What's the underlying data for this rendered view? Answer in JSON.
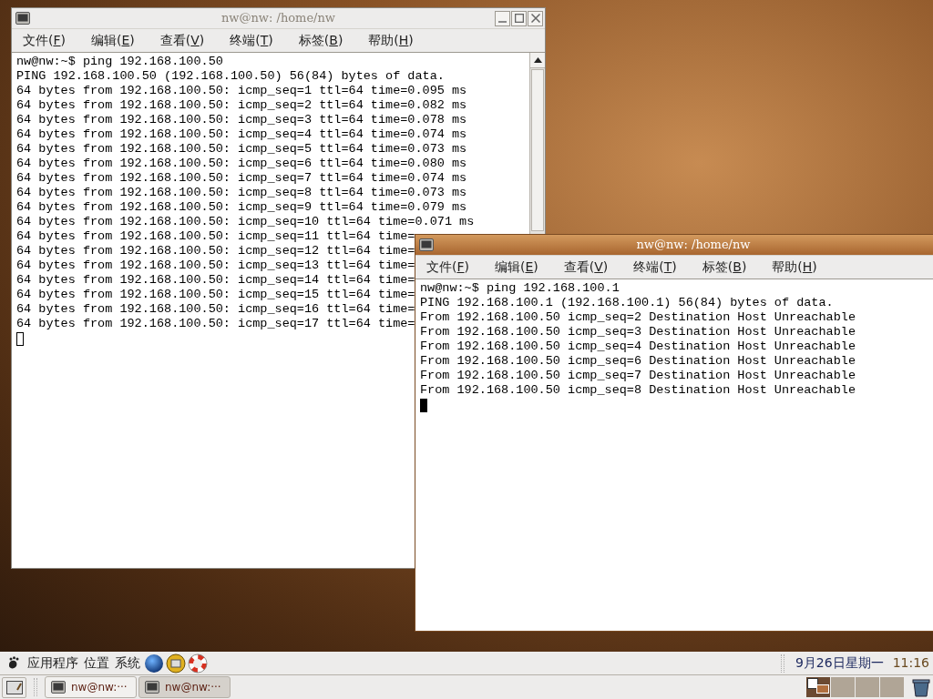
{
  "windows": [
    {
      "title": "nw@nw: /home/nw",
      "active": false,
      "controls_shown": true,
      "menu": [
        "文件(F)",
        "编辑(E)",
        "查看(V)",
        "终端(T)",
        "标签(B)",
        "帮助(H)"
      ],
      "lines": [
        "nw@nw:~$ ping 192.168.100.50",
        "PING 192.168.100.50 (192.168.100.50) 56(84) bytes of data.",
        "64 bytes from 192.168.100.50: icmp_seq=1 ttl=64 time=0.095 ms",
        "64 bytes from 192.168.100.50: icmp_seq=2 ttl=64 time=0.082 ms",
        "64 bytes from 192.168.100.50: icmp_seq=3 ttl=64 time=0.078 ms",
        "64 bytes from 192.168.100.50: icmp_seq=4 ttl=64 time=0.074 ms",
        "64 bytes from 192.168.100.50: icmp_seq=5 ttl=64 time=0.073 ms",
        "64 bytes from 192.168.100.50: icmp_seq=6 ttl=64 time=0.080 ms",
        "64 bytes from 192.168.100.50: icmp_seq=7 ttl=64 time=0.074 ms",
        "64 bytes from 192.168.100.50: icmp_seq=8 ttl=64 time=0.073 ms",
        "64 bytes from 192.168.100.50: icmp_seq=9 ttl=64 time=0.079 ms",
        "64 bytes from 192.168.100.50: icmp_seq=10 ttl=64 time=0.071 ms",
        "64 bytes from 192.168.100.50: icmp_seq=11 ttl=64 time=",
        "64 bytes from 192.168.100.50: icmp_seq=12 ttl=64 time=",
        "64 bytes from 192.168.100.50: icmp_seq=13 ttl=64 time=",
        "64 bytes from 192.168.100.50: icmp_seq=14 ttl=64 time=",
        "64 bytes from 192.168.100.50: icmp_seq=15 ttl=64 time=",
        "64 bytes from 192.168.100.50: icmp_seq=16 ttl=64 time=",
        "64 bytes from 192.168.100.50: icmp_seq=17 ttl=64 time="
      ]
    },
    {
      "title": "nw@nw: /home/nw",
      "active": true,
      "controls_shown": false,
      "menu": [
        "文件(F)",
        "编辑(E)",
        "查看(V)",
        "终端(T)",
        "标签(B)",
        "帮助(H)"
      ],
      "lines": [
        "nw@nw:~$ ping 192.168.100.1",
        "PING 192.168.100.1 (192.168.100.1) 56(84) bytes of data.",
        "From 192.168.100.50 icmp_seq=2 Destination Host Unreachable",
        "From 192.168.100.50 icmp_seq=3 Destination Host Unreachable",
        "From 192.168.100.50 icmp_seq=4 Destination Host Unreachable",
        "From 192.168.100.50 icmp_seq=6 Destination Host Unreachable",
        "From 192.168.100.50 icmp_seq=7 Destination Host Unreachable",
        "From 192.168.100.50 icmp_seq=8 Destination Host Unreachable"
      ]
    }
  ],
  "top_panel": {
    "menus": [
      "应用程序",
      "位置",
      "系统"
    ],
    "date": "9月26日星期一",
    "time": "11:16"
  },
  "taskbar": {
    "tasks": [
      {
        "label": "nw@nw:···",
        "selected": false
      },
      {
        "label": "nw@nw:···",
        "selected": true
      }
    ],
    "workspaces": [
      {
        "selected": true
      },
      {
        "selected": false
      },
      {
        "selected": false
      },
      {
        "selected": false
      }
    ]
  }
}
